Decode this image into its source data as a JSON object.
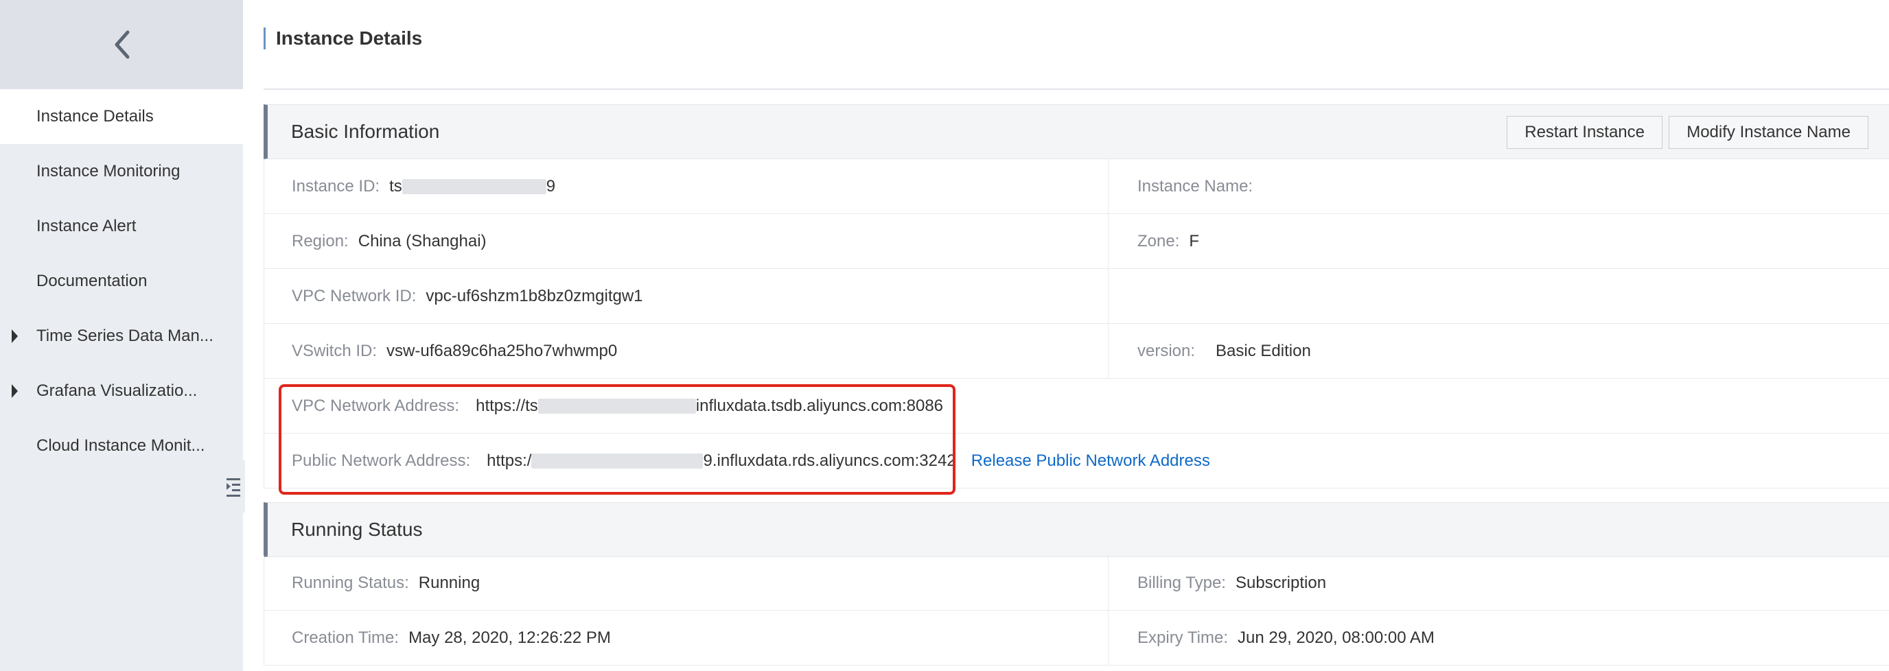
{
  "sidebar": {
    "back_icon": "chevron-left-icon",
    "items": [
      {
        "label": "Instance Details",
        "active": true,
        "expandable": false
      },
      {
        "label": "Instance Monitoring",
        "active": false,
        "expandable": false
      },
      {
        "label": "Instance Alert",
        "active": false,
        "expandable": false
      },
      {
        "label": "Documentation",
        "active": false,
        "expandable": false
      },
      {
        "label": "Time Series Data Man...",
        "active": false,
        "expandable": true
      },
      {
        "label": "Grafana Visualizatio...",
        "active": false,
        "expandable": true
      },
      {
        "label": "Cloud Instance Monit...",
        "active": false,
        "expandable": false
      }
    ],
    "collapse_icon": "collapse-sidebar-icon"
  },
  "header": {
    "title": "Instance Details"
  },
  "basic_info": {
    "title": "Basic Information",
    "restart_label": "Restart Instance",
    "modify_label": "Modify Instance Name",
    "instance_id_label": "Instance ID:",
    "instance_id_prefix": "ts",
    "instance_id_suffix": "9",
    "instance_name_label": "Instance Name:",
    "region_label": "Region:",
    "region_value": "China (Shanghai)",
    "zone_label": "Zone:",
    "zone_value": "F",
    "vpc_id_label": "VPC Network ID:",
    "vpc_id_value": "vpc-uf6shzm1b8bz0zmgitgw1",
    "vswitch_label": "VSwitch ID:",
    "vswitch_value": "vsw-uf6a89c6ha25ho7whwmp0",
    "version_label": "version:",
    "version_value": "Basic Edition",
    "vpc_addr_label": "VPC Network Address:",
    "vpc_addr_prefix": "https://ts",
    "vpc_addr_suffix": "influxdata.tsdb.aliyuncs.com:8086",
    "public_addr_label": "Public Network Address:",
    "public_addr_prefix": "https:/",
    "public_addr_suffix": "9.influxdata.rds.aliyuncs.com:3242",
    "release_link": "Release Public Network Address"
  },
  "running_status": {
    "title": "Running Status",
    "status_label": "Running Status:",
    "status_value": "Running",
    "billing_label": "Billing Type:",
    "billing_value": "Subscription",
    "creation_label": "Creation Time:",
    "creation_value": "May 28, 2020, 12:26:22 PM",
    "expiry_label": "Expiry Time:",
    "expiry_value": "Jun 29, 2020, 08:00:00 AM"
  },
  "colors": {
    "accent_link": "#0f6ac6",
    "highlight": "#e1251b",
    "sidebar_bg": "#eaedf1"
  }
}
